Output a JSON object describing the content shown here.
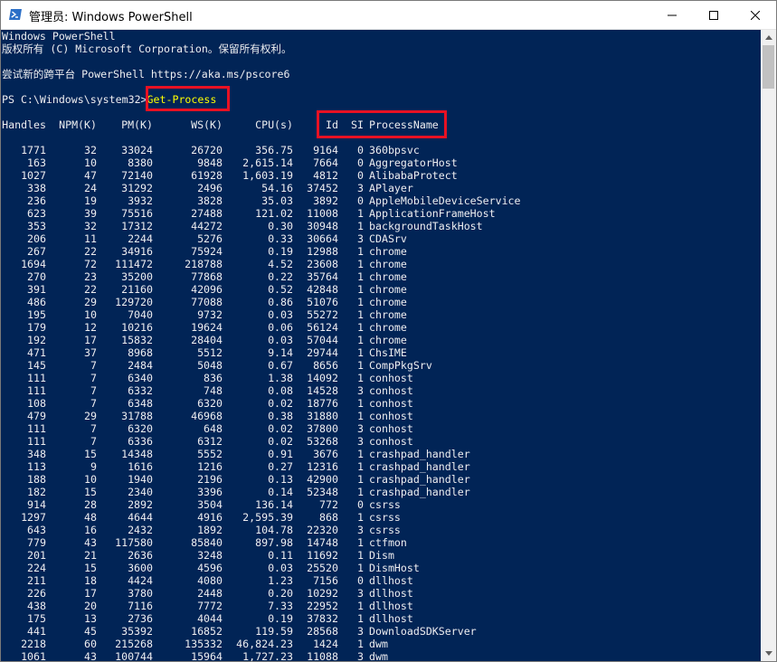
{
  "window": {
    "title": "管理员: Windows PowerShell"
  },
  "console": {
    "banner_line1": "Windows PowerShell",
    "banner_line2": "版权所有 (C) Microsoft Corporation。保留所有权利。",
    "banner_line3": "尝试新的跨平台 PowerShell https://aka.ms/pscore6",
    "prompt": "PS C:\\Windows\\system32>",
    "command": "Get-Process"
  },
  "table": {
    "headers": [
      "Handles",
      "NPM(K)",
      "PM(K)",
      "WS(K)",
      "CPU(s)",
      "Id",
      "SI",
      "ProcessName"
    ],
    "dashes": [
      "-------",
      "------",
      "-----",
      "-----",
      "------",
      "--",
      "--",
      "-----------"
    ],
    "rows": [
      [
        "1771",
        "32",
        "33024",
        "26720",
        "356.75",
        "9164",
        "0",
        "360bpsvc"
      ],
      [
        "163",
        "10",
        "8380",
        "9848",
        "2,615.14",
        "7664",
        "0",
        "AggregatorHost"
      ],
      [
        "1027",
        "47",
        "72140",
        "61928",
        "1,603.19",
        "4812",
        "0",
        "AlibabaProtect"
      ],
      [
        "338",
        "24",
        "31292",
        "2496",
        "54.16",
        "37452",
        "3",
        "APlayer"
      ],
      [
        "236",
        "19",
        "3932",
        "3828",
        "35.03",
        "3892",
        "0",
        "AppleMobileDeviceService"
      ],
      [
        "623",
        "39",
        "75516",
        "27488",
        "121.02",
        "11008",
        "1",
        "ApplicationFrameHost"
      ],
      [
        "353",
        "32",
        "17312",
        "44272",
        "0.30",
        "30948",
        "1",
        "backgroundTaskHost"
      ],
      [
        "206",
        "11",
        "2244",
        "5276",
        "0.33",
        "30664",
        "3",
        "CDASrv"
      ],
      [
        "267",
        "22",
        "34916",
        "75924",
        "0.19",
        "12988",
        "1",
        "chrome"
      ],
      [
        "1694",
        "72",
        "111472",
        "218788",
        "4.52",
        "23608",
        "1",
        "chrome"
      ],
      [
        "270",
        "23",
        "35200",
        "77868",
        "0.22",
        "35764",
        "1",
        "chrome"
      ],
      [
        "391",
        "22",
        "21160",
        "42096",
        "0.52",
        "42848",
        "1",
        "chrome"
      ],
      [
        "486",
        "29",
        "129720",
        "77088",
        "0.86",
        "51076",
        "1",
        "chrome"
      ],
      [
        "195",
        "10",
        "7040",
        "9732",
        "0.03",
        "55272",
        "1",
        "chrome"
      ],
      [
        "179",
        "12",
        "10216",
        "19624",
        "0.06",
        "56124",
        "1",
        "chrome"
      ],
      [
        "192",
        "17",
        "15832",
        "28404",
        "0.03",
        "57044",
        "1",
        "chrome"
      ],
      [
        "471",
        "37",
        "8968",
        "5512",
        "9.14",
        "29744",
        "1",
        "ChsIME"
      ],
      [
        "145",
        "7",
        "2484",
        "5048",
        "0.67",
        "8656",
        "1",
        "CompPkgSrv"
      ],
      [
        "111",
        "7",
        "6340",
        "836",
        "1.38",
        "14092",
        "1",
        "conhost"
      ],
      [
        "111",
        "7",
        "6332",
        "748",
        "0.08",
        "14528",
        "3",
        "conhost"
      ],
      [
        "108",
        "7",
        "6348",
        "6320",
        "0.02",
        "18776",
        "1",
        "conhost"
      ],
      [
        "479",
        "29",
        "31788",
        "46968",
        "0.38",
        "31880",
        "1",
        "conhost"
      ],
      [
        "111",
        "7",
        "6320",
        "648",
        "0.02",
        "37800",
        "3",
        "conhost"
      ],
      [
        "111",
        "7",
        "6336",
        "6312",
        "0.02",
        "53268",
        "3",
        "conhost"
      ],
      [
        "348",
        "15",
        "14348",
        "5552",
        "0.91",
        "3676",
        "1",
        "crashpad_handler"
      ],
      [
        "113",
        "9",
        "1616",
        "1216",
        "0.27",
        "12316",
        "1",
        "crashpad_handler"
      ],
      [
        "188",
        "10",
        "1940",
        "2196",
        "0.13",
        "42900",
        "1",
        "crashpad_handler"
      ],
      [
        "182",
        "15",
        "2340",
        "3396",
        "0.14",
        "52348",
        "1",
        "crashpad_handler"
      ],
      [
        "914",
        "28",
        "2892",
        "3504",
        "136.14",
        "772",
        "0",
        "csrss"
      ],
      [
        "1297",
        "48",
        "4644",
        "4916",
        "2,595.39",
        "868",
        "1",
        "csrss"
      ],
      [
        "643",
        "16",
        "2432",
        "1892",
        "104.78",
        "22320",
        "3",
        "csrss"
      ],
      [
        "779",
        "43",
        "117580",
        "85840",
        "897.98",
        "14748",
        "1",
        "ctfmon"
      ],
      [
        "201",
        "21",
        "2636",
        "3248",
        "0.11",
        "11692",
        "1",
        "Dism"
      ],
      [
        "224",
        "15",
        "3600",
        "4596",
        "0.03",
        "25520",
        "1",
        "DismHost"
      ],
      [
        "211",
        "18",
        "4424",
        "4080",
        "1.23",
        "7156",
        "0",
        "dllhost"
      ],
      [
        "226",
        "17",
        "3780",
        "2448",
        "0.20",
        "10292",
        "3",
        "dllhost"
      ],
      [
        "438",
        "20",
        "7116",
        "7772",
        "7.33",
        "22952",
        "1",
        "dllhost"
      ],
      [
        "175",
        "13",
        "2736",
        "4044",
        "0.19",
        "37832",
        "1",
        "dllhost"
      ],
      [
        "441",
        "45",
        "35392",
        "16852",
        "119.59",
        "28568",
        "3",
        "DownloadSDKServer"
      ],
      [
        "2218",
        "60",
        "215268",
        "135332",
        "46,824.23",
        "1424",
        "1",
        "dwm"
      ],
      [
        "1061",
        "43",
        "100744",
        "15964",
        "1,727.23",
        "11088",
        "3",
        "dwm"
      ]
    ]
  },
  "colors": {
    "console_bg": "#012456",
    "console_fg": "#eeedf0",
    "command": "#ffff00",
    "highlight": "#e81123"
  },
  "icons": [
    "powershell-icon",
    "minimize-icon",
    "maximize-icon",
    "close-icon",
    "scroll-up-icon",
    "scroll-down-icon"
  ]
}
